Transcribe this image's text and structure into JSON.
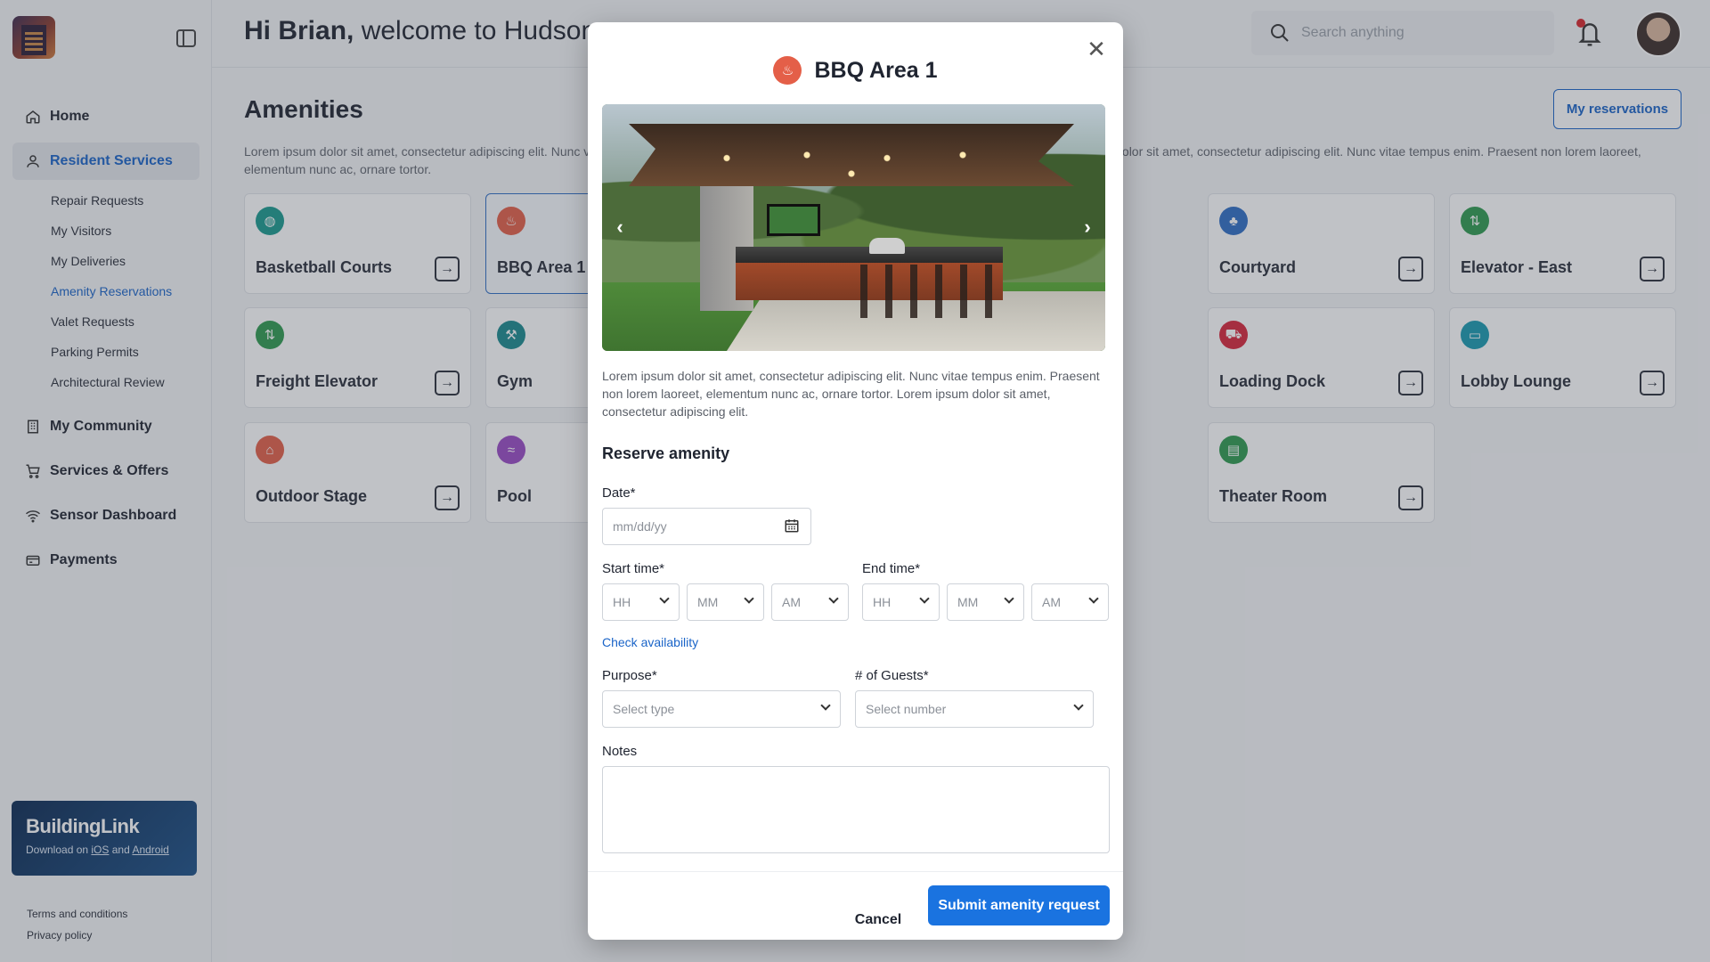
{
  "header": {
    "greeting_name": "Hi Brian,",
    "greeting_rest": " welcome to Hudson",
    "search_placeholder": "Search anything"
  },
  "sidebar": {
    "nav": [
      {
        "label": "Home",
        "icon": "home-icon"
      },
      {
        "label": "Resident Services",
        "icon": "user-icon",
        "active": true
      },
      {
        "label": "My Community",
        "icon": "building-icon"
      },
      {
        "label": "Services & Offers",
        "icon": "cart-icon"
      },
      {
        "label": "Sensor Dashboard",
        "icon": "wifi-icon"
      },
      {
        "label": "Payments",
        "icon": "card-icon"
      }
    ],
    "subnav": [
      "Repair Requests",
      "My Visitors",
      "My Deliveries",
      "Amenity Reservations",
      "Valet Requests",
      "Parking Permits",
      "Architectural Review"
    ],
    "promo": {
      "brand": "BuildingLink",
      "text_prefix": "Download on ",
      "ios": "iOS",
      "and": " and ",
      "android": "Android"
    },
    "legal": [
      "Terms and conditions",
      "Privacy policy"
    ]
  },
  "main": {
    "title": "Amenities",
    "reservations_button": "My reservations",
    "intro": "Lorem ipsum dolor sit amet, consectetur adipiscing elit. Nunc vitae tempus enim. Praesent non lorem laoreet, elementum nunc ac, ornare tortor. Lorem ipsum dolor sit amet, consectetur adipiscing elit. Nunc vitae tempus enim. Praesent non lorem laoreet, elementum nunc ac, ornare tortor.",
    "cards": [
      {
        "label": "Basketball Courts",
        "color": "#1a9a8e",
        "icon": "basketball-icon"
      },
      {
        "label": "BBQ Area 1",
        "color": "#e45f48",
        "icon": "grill-icon"
      },
      {
        "label": "Courtyard",
        "color": "#2f6dc4",
        "icon": "tree-icon"
      },
      {
        "label": "Elevator - East",
        "color": "#2e9a4e",
        "icon": "elevator-icon"
      },
      {
        "label": "Freight Elevator",
        "color": "#2e9a4e",
        "icon": "elevator-icon"
      },
      {
        "label": "Gym",
        "color": "#1a8a8e",
        "icon": "dumbbell-icon"
      },
      {
        "label": "Loading Dock",
        "color": "#d8263a",
        "icon": "truck-icon"
      },
      {
        "label": "Lobby Lounge",
        "color": "#1a9ab0",
        "icon": "sofa-icon"
      },
      {
        "label": "Outdoor Stage",
        "color": "#e45f48",
        "icon": "stage-icon"
      },
      {
        "label": "Pool",
        "color": "#9a4ac4",
        "icon": "pool-icon"
      },
      {
        "label": "Theater Room",
        "color": "#2e9a4e",
        "icon": "film-icon"
      }
    ]
  },
  "modal": {
    "title": "BBQ Area 1",
    "description": "Lorem ipsum dolor sit amet, consectetur adipiscing elit. Nunc vitae tempus enim. Praesent non lorem laoreet, elementum nunc ac, ornare tortor.  Lorem ipsum dolor sit amet, consectetur adipiscing elit.",
    "section": "Reserve amenity",
    "date_label": "Date*",
    "date_placeholder": "mm/dd/yy",
    "start_label": "Start time*",
    "end_label": "End time*",
    "hh": "HH",
    "mm": "MM",
    "ampm": "AM",
    "check_availability": "Check availability",
    "purpose_label": "Purpose*",
    "purpose_placeholder": "Select type",
    "guests_label": "# of Guests*",
    "guests_placeholder": "Select number",
    "notes_label": "Notes",
    "cancel": "Cancel",
    "submit": "Submit amenity request"
  },
  "colors": {
    "accent": "#1a73e0",
    "link": "#1a64c8",
    "promo_bg": "#0c2a52"
  }
}
